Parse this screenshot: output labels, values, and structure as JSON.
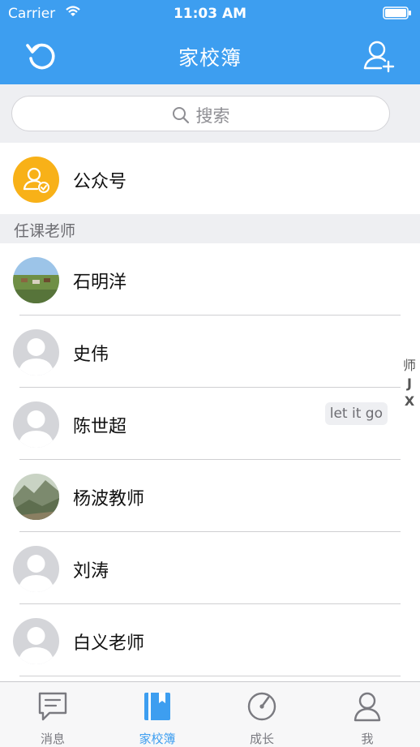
{
  "status_bar": {
    "carrier": "Carrier",
    "time": "11:03 AM"
  },
  "navbar": {
    "title": "家校簿",
    "left_icon": "refresh-icon",
    "right_icon": "add-user-icon"
  },
  "search": {
    "placeholder": "搜索"
  },
  "official": {
    "label": "公众号",
    "icon": "account-check-icon",
    "color": "#f8b118"
  },
  "section": {
    "title": "任课老师"
  },
  "teachers": [
    {
      "name": "石明洋",
      "avatar": "landscape-photo"
    },
    {
      "name": "史伟",
      "avatar": "default-avatar"
    },
    {
      "name": "陈世超",
      "avatar": "default-avatar",
      "tag": "let it go"
    },
    {
      "name": "杨波教师",
      "avatar": "landscape-photo"
    },
    {
      "name": "刘涛",
      "avatar": "default-avatar"
    },
    {
      "name": "白义老师",
      "avatar": "default-avatar"
    }
  ],
  "index": [
    "师",
    "J",
    "X"
  ],
  "tabs": [
    {
      "label": "消息",
      "icon": "message-icon",
      "active": false
    },
    {
      "label": "家校簿",
      "icon": "book-icon",
      "active": true
    },
    {
      "label": "成长",
      "icon": "growth-icon",
      "active": false
    },
    {
      "label": "我",
      "icon": "profile-icon",
      "active": false
    }
  ],
  "colors": {
    "accent": "#3d9ef0",
    "background": "#eeeff2"
  }
}
